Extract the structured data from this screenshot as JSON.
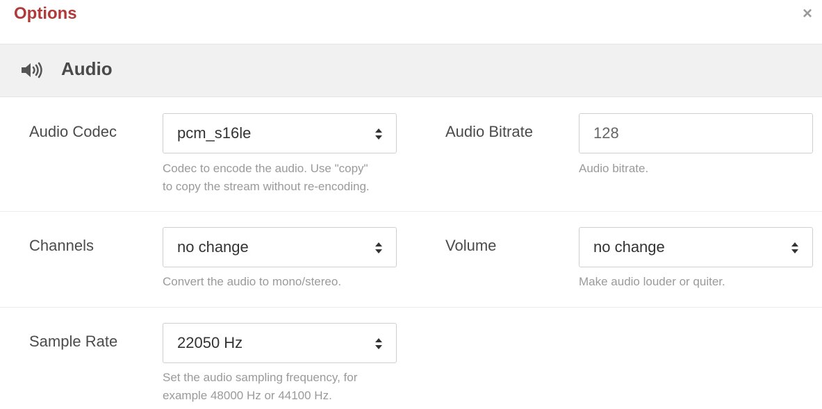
{
  "dialog": {
    "title": "Options",
    "close_label": "×",
    "close_icon": "close-icon"
  },
  "section": {
    "title": "Audio",
    "icon": "speaker-icon"
  },
  "fields": {
    "audio_codec": {
      "label": "Audio Codec",
      "value": "pcm_s16le",
      "help_line1": "Codec to encode the audio. Use \"copy\"",
      "help_line2": "to copy the stream without re-encoding."
    },
    "audio_bitrate": {
      "label": "Audio Bitrate",
      "value": "128",
      "help_line1": "Audio bitrate."
    },
    "channels": {
      "label": "Channels",
      "value": "no change",
      "help_line1": "Convert the audio to mono/stereo."
    },
    "volume": {
      "label": "Volume",
      "value": "no change",
      "help_line1": "Make audio louder or quiter."
    },
    "sample_rate": {
      "label": "Sample Rate",
      "value": "22050 Hz",
      "help_line1": "Set the audio sampling frequency, for",
      "help_line2": "example 48000 Hz or 44100 Hz."
    }
  },
  "colors": {
    "title": "#b03a3a",
    "section_bg": "#f1f1f1",
    "help_text": "#9a9a9a"
  }
}
